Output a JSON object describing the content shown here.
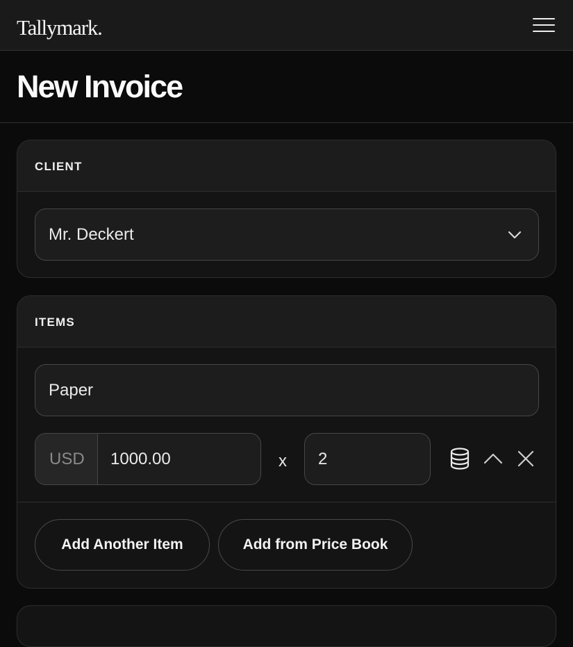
{
  "app": {
    "logo": "Tallymark."
  },
  "page": {
    "title": "New Invoice"
  },
  "client": {
    "heading": "CLIENT",
    "selected": "Mr. Deckert"
  },
  "items": {
    "heading": "ITEMS",
    "list": [
      {
        "description": "Paper",
        "currency": "USD",
        "price": "1000.00",
        "multiplier": "x",
        "quantity": "2"
      }
    ],
    "add_another_label": "Add Another Item",
    "add_from_price_book_label": "Add from Price Book"
  },
  "icons": [
    "menu-icon",
    "chevron-down-icon",
    "database-icon",
    "chevron-up-icon",
    "close-icon"
  ],
  "colors": {
    "background": "#0b0b0b",
    "card": "#141414",
    "card_header": "#1c1c1c",
    "border": "#474747",
    "text": "#f2f2f2",
    "muted": "#8a8a8a"
  }
}
